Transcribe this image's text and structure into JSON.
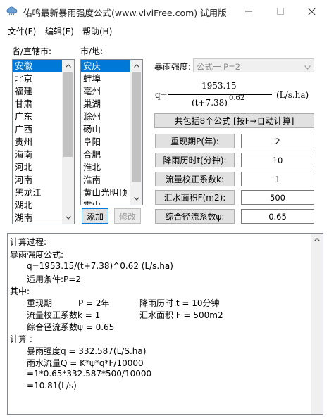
{
  "window": {
    "title": "佑鸣最新暴雨强度公式(www.viviFree.com) 试用版"
  },
  "menu": [
    "文件(F)",
    "编辑(E)",
    "帮助(H)"
  ],
  "province": {
    "label": "省/直辖市:",
    "items": [
      "安徽",
      "北京",
      "福建",
      "甘肃",
      "广东",
      "广西",
      "贵州",
      "海南",
      "河北",
      "河南",
      "黑龙江",
      "湖北",
      "湖南"
    ],
    "selected_index": 0
  },
  "city": {
    "label": "市/地:",
    "items": [
      "安庆",
      "蚌埠",
      "亳州",
      "巢湖",
      "滁州",
      "砀山",
      "阜阳",
      "合肥",
      "淮北",
      "淮南",
      "黄山光明顶",
      "霍山"
    ],
    "selected_index": 0
  },
  "buttons": {
    "add": "添加",
    "modify": "修改",
    "compute": "共包括8个公式 [按F→自动计算]"
  },
  "formula": {
    "label": "暴雨强度:",
    "selected": "公式一 P=2",
    "q_prefix": "q=",
    "numerator": "1953.15",
    "denominator": "(t+7.38)",
    "exponent": "0.62",
    "unit": "(L/s.ha)"
  },
  "params": [
    {
      "label": "重现期P(年):",
      "value": "2"
    },
    {
      "label": "降雨历时t(分钟):",
      "value": "10"
    },
    {
      "label": "流量校正系数k:",
      "value": "1"
    },
    {
      "label": "汇水面积F(m2):",
      "value": "500"
    },
    {
      "label": "综合径流系数ψ:",
      "value": "0.65"
    }
  ],
  "output": {
    "lines": [
      "计算过程:",
      "暴雨强度公式:",
      "q=1953.15/(t+7.38)^0.62 (L/s.ha)",
      "适用条件:P=2",
      "其中:",
      "重现期",
      "P = 2年",
      "降雨历时 t = 10分钟",
      "流量校正系数k = 1",
      "汇水面积 F = 500m2",
      "综合径流系数ψ = 0.65",
      "计算 :",
      "暴雨强度q = 332.587(L/S.ha)",
      "雨水流量Q = K*ψ*q*F/10000",
      "=1*0.65*332.587*500/10000",
      "=10.81(L/s)"
    ]
  }
}
